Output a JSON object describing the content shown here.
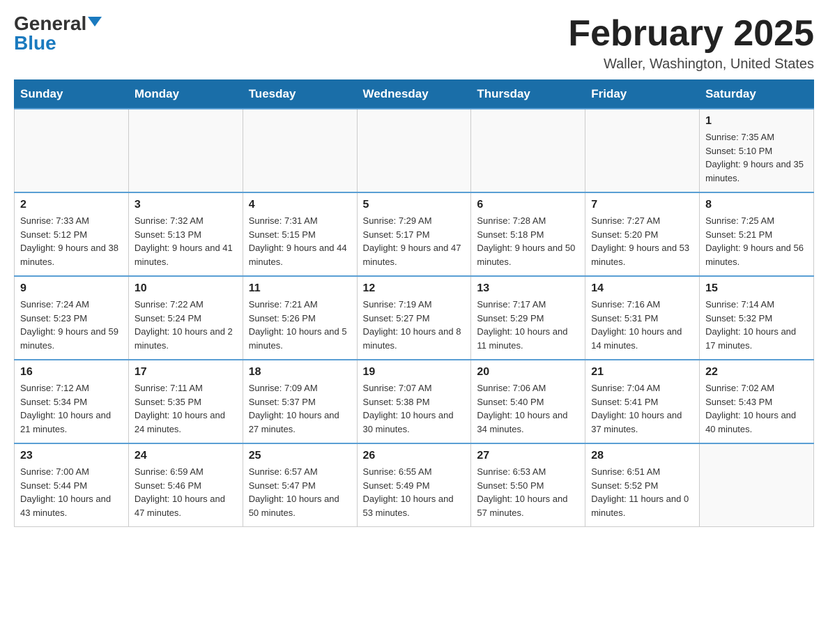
{
  "header": {
    "logo_general": "General",
    "logo_blue": "Blue",
    "month_title": "February 2025",
    "location": "Waller, Washington, United States"
  },
  "days_of_week": [
    "Sunday",
    "Monday",
    "Tuesday",
    "Wednesday",
    "Thursday",
    "Friday",
    "Saturday"
  ],
  "weeks": [
    [
      {
        "day": "",
        "info": ""
      },
      {
        "day": "",
        "info": ""
      },
      {
        "day": "",
        "info": ""
      },
      {
        "day": "",
        "info": ""
      },
      {
        "day": "",
        "info": ""
      },
      {
        "day": "",
        "info": ""
      },
      {
        "day": "1",
        "info": "Sunrise: 7:35 AM\nSunset: 5:10 PM\nDaylight: 9 hours and 35 minutes."
      }
    ],
    [
      {
        "day": "2",
        "info": "Sunrise: 7:33 AM\nSunset: 5:12 PM\nDaylight: 9 hours and 38 minutes."
      },
      {
        "day": "3",
        "info": "Sunrise: 7:32 AM\nSunset: 5:13 PM\nDaylight: 9 hours and 41 minutes."
      },
      {
        "day": "4",
        "info": "Sunrise: 7:31 AM\nSunset: 5:15 PM\nDaylight: 9 hours and 44 minutes."
      },
      {
        "day": "5",
        "info": "Sunrise: 7:29 AM\nSunset: 5:17 PM\nDaylight: 9 hours and 47 minutes."
      },
      {
        "day": "6",
        "info": "Sunrise: 7:28 AM\nSunset: 5:18 PM\nDaylight: 9 hours and 50 minutes."
      },
      {
        "day": "7",
        "info": "Sunrise: 7:27 AM\nSunset: 5:20 PM\nDaylight: 9 hours and 53 minutes."
      },
      {
        "day": "8",
        "info": "Sunrise: 7:25 AM\nSunset: 5:21 PM\nDaylight: 9 hours and 56 minutes."
      }
    ],
    [
      {
        "day": "9",
        "info": "Sunrise: 7:24 AM\nSunset: 5:23 PM\nDaylight: 9 hours and 59 minutes."
      },
      {
        "day": "10",
        "info": "Sunrise: 7:22 AM\nSunset: 5:24 PM\nDaylight: 10 hours and 2 minutes."
      },
      {
        "day": "11",
        "info": "Sunrise: 7:21 AM\nSunset: 5:26 PM\nDaylight: 10 hours and 5 minutes."
      },
      {
        "day": "12",
        "info": "Sunrise: 7:19 AM\nSunset: 5:27 PM\nDaylight: 10 hours and 8 minutes."
      },
      {
        "day": "13",
        "info": "Sunrise: 7:17 AM\nSunset: 5:29 PM\nDaylight: 10 hours and 11 minutes."
      },
      {
        "day": "14",
        "info": "Sunrise: 7:16 AM\nSunset: 5:31 PM\nDaylight: 10 hours and 14 minutes."
      },
      {
        "day": "15",
        "info": "Sunrise: 7:14 AM\nSunset: 5:32 PM\nDaylight: 10 hours and 17 minutes."
      }
    ],
    [
      {
        "day": "16",
        "info": "Sunrise: 7:12 AM\nSunset: 5:34 PM\nDaylight: 10 hours and 21 minutes."
      },
      {
        "day": "17",
        "info": "Sunrise: 7:11 AM\nSunset: 5:35 PM\nDaylight: 10 hours and 24 minutes."
      },
      {
        "day": "18",
        "info": "Sunrise: 7:09 AM\nSunset: 5:37 PM\nDaylight: 10 hours and 27 minutes."
      },
      {
        "day": "19",
        "info": "Sunrise: 7:07 AM\nSunset: 5:38 PM\nDaylight: 10 hours and 30 minutes."
      },
      {
        "day": "20",
        "info": "Sunrise: 7:06 AM\nSunset: 5:40 PM\nDaylight: 10 hours and 34 minutes."
      },
      {
        "day": "21",
        "info": "Sunrise: 7:04 AM\nSunset: 5:41 PM\nDaylight: 10 hours and 37 minutes."
      },
      {
        "day": "22",
        "info": "Sunrise: 7:02 AM\nSunset: 5:43 PM\nDaylight: 10 hours and 40 minutes."
      }
    ],
    [
      {
        "day": "23",
        "info": "Sunrise: 7:00 AM\nSunset: 5:44 PM\nDaylight: 10 hours and 43 minutes."
      },
      {
        "day": "24",
        "info": "Sunrise: 6:59 AM\nSunset: 5:46 PM\nDaylight: 10 hours and 47 minutes."
      },
      {
        "day": "25",
        "info": "Sunrise: 6:57 AM\nSunset: 5:47 PM\nDaylight: 10 hours and 50 minutes."
      },
      {
        "day": "26",
        "info": "Sunrise: 6:55 AM\nSunset: 5:49 PM\nDaylight: 10 hours and 53 minutes."
      },
      {
        "day": "27",
        "info": "Sunrise: 6:53 AM\nSunset: 5:50 PM\nDaylight: 10 hours and 57 minutes."
      },
      {
        "day": "28",
        "info": "Sunrise: 6:51 AM\nSunset: 5:52 PM\nDaylight: 11 hours and 0 minutes."
      },
      {
        "day": "",
        "info": ""
      }
    ]
  ]
}
